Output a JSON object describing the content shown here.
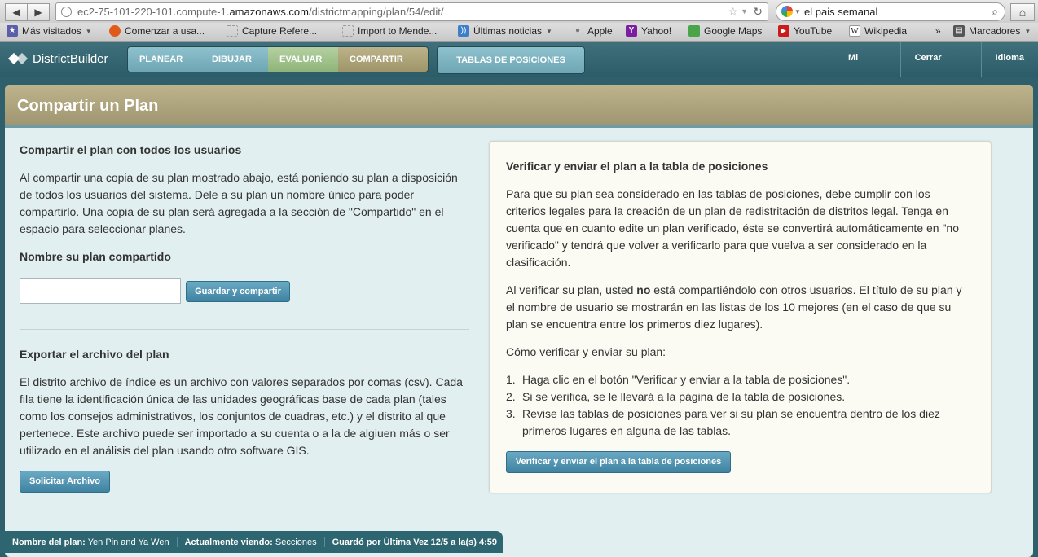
{
  "browser": {
    "url_prefix": "ec2-75-101-220-101.compute-1.",
    "url_domain": "amazonaws.com",
    "url_path": "/districtmapping/plan/54/edit/",
    "search_text": "el pais semanal",
    "bookmarks": [
      {
        "label": "Más visitados",
        "icon": "star-folder-icon",
        "color": "#5b5ea8"
      },
      {
        "label": "Comenzar a usa...",
        "icon": "firefox-icon",
        "color": "#e05a1a"
      },
      {
        "label": "Capture Refere...",
        "icon": "page-icon",
        "color": "#999999"
      },
      {
        "label": "Import to Mende...",
        "icon": "page-icon",
        "color": "#999999"
      },
      {
        "label": "Últimas noticias",
        "icon": "rss-icon",
        "color": "#3c7ec9"
      },
      {
        "label": "Apple",
        "icon": "apple-icon",
        "color": "#777777"
      },
      {
        "label": "Yahoo!",
        "icon": "yahoo-icon",
        "color": "#7b1fa2"
      },
      {
        "label": "Google Maps",
        "icon": "maps-icon",
        "color": "#4aa54a"
      },
      {
        "label": "YouTube",
        "icon": "youtube-icon",
        "color": "#cc1b1b"
      },
      {
        "label": "Wikipedia",
        "icon": "wikipedia-icon",
        "color": "#444444"
      },
      {
        "label": "Marcadores",
        "icon": "bookmarks-icon",
        "color": "#555555"
      }
    ]
  },
  "app": {
    "logo": "DistrictBuilder",
    "tabs": [
      "PLANEAR",
      "DIBUJAR",
      "EVALUAR",
      "COMPARTIR"
    ],
    "leaderboard": "TABLAS DE POSICIONES",
    "links": [
      "Mi Cuenta",
      "Cerrar Sesión",
      "Idioma"
    ]
  },
  "panel": {
    "title": "Compartir un Plan",
    "share": {
      "heading": "Compartir el plan con todos los usuarios",
      "body": "Al compartir una copia de su plan mostrado abajo, está poniendo su plan a disposición de todos los usuarios del sistema. Dele a su plan un nombre único para poder compartirlo. Una copia de su plan será agregada a la sección de \"Compartido\" en el espacio para seleccionar planes.",
      "name_label": "Nombre su plan compartido",
      "name_value": "",
      "button": "Guardar y compartir"
    },
    "export": {
      "heading": "Exportar el archivo del plan",
      "body": "El distrito archivo de índice es un archivo con valores separados por comas (csv). Cada fila tiene la identificación única de las unidades geográficas base de cada plan (tales como los consejos administrativos, los conjuntos de cuadras, etc.) y el distrito al que pertenece. Este archivo puede ser importado a su cuenta o a la de algiuen más o ser utilizado en el análisis del plan usando otro software GIS.",
      "button": "Solicitar Archivo"
    },
    "verify": {
      "heading": "Verificar y enviar el plan a la tabla de posiciones",
      "para1": "Para que su plan sea considerado en las tablas de posiciones, debe cumplir con los criterios legales para la creación de un plan de redistritación de distritos legal. Tenga en cuenta que en cuanto edite un plan verificado, éste se convertirá automáticamente en \"no verificado\" y tendrá que volver a verificarlo para que vuelva a ser considerado en la clasificación.",
      "para2_pre": "Al verificar su plan, usted ",
      "para2_bold": "no",
      "para2_post": " está compartiéndolo con otros usuarios. El título de su plan y el nombre de usuario se mostrarán en las listas de los 10 mejores (en el caso de que su plan se encuentra entre los primeros diez lugares).",
      "how": "Cómo verificar y enviar su plan:",
      "steps": [
        "Haga clic en el botón \"Verificar y enviar a la tabla de posiciones\".",
        "Si se verifica, se le llevará a la página de la tabla de posiciones.",
        "Revise las tablas de posiciones para ver si su plan se encuentra dentro de los diez primeros lugares en alguna de las tablas."
      ],
      "step_numbers": [
        "1.",
        "2.",
        "3."
      ],
      "button": "Verificar y enviar el plan a la tabla de posiciones"
    }
  },
  "status": {
    "plan_label": "Nombre del plan:",
    "plan_value": "Yen Pin and Ya Wen",
    "viewing_label": "Actualmente viendo:",
    "viewing_value": "Secciones",
    "saved_label": "Guardó por Última Vez 12/5 a la(s) 4:59"
  }
}
